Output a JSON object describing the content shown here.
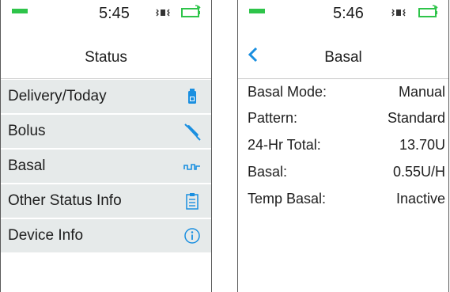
{
  "colors": {
    "accent": "#1a8fe0",
    "battery_green": "#2ec44a",
    "menu_bg": "#e6eaea",
    "text": "#1e1e1e"
  },
  "left_screen": {
    "time": "5:45",
    "title": "Status",
    "items": [
      {
        "label": "Delivery/Today",
        "icon": "insulin-cartridge-icon"
      },
      {
        "label": "Bolus",
        "icon": "pen-injector-icon"
      },
      {
        "label": "Basal",
        "icon": "basal-pulse-icon"
      },
      {
        "label": "Other Status Info",
        "icon": "clipboard-icon"
      },
      {
        "label": "Device Info",
        "icon": "info-icon"
      }
    ]
  },
  "right_screen": {
    "time": "5:46",
    "title": "Basal",
    "rows": [
      {
        "key": "Basal Mode:",
        "value": "Manual"
      },
      {
        "key": "Pattern:",
        "value": "Standard"
      },
      {
        "key": "24-Hr Total:",
        "value": "13.70U"
      },
      {
        "key": "Basal:",
        "value": "0.55U/H"
      },
      {
        "key": "Temp Basal:",
        "value": "Inactive"
      }
    ]
  }
}
